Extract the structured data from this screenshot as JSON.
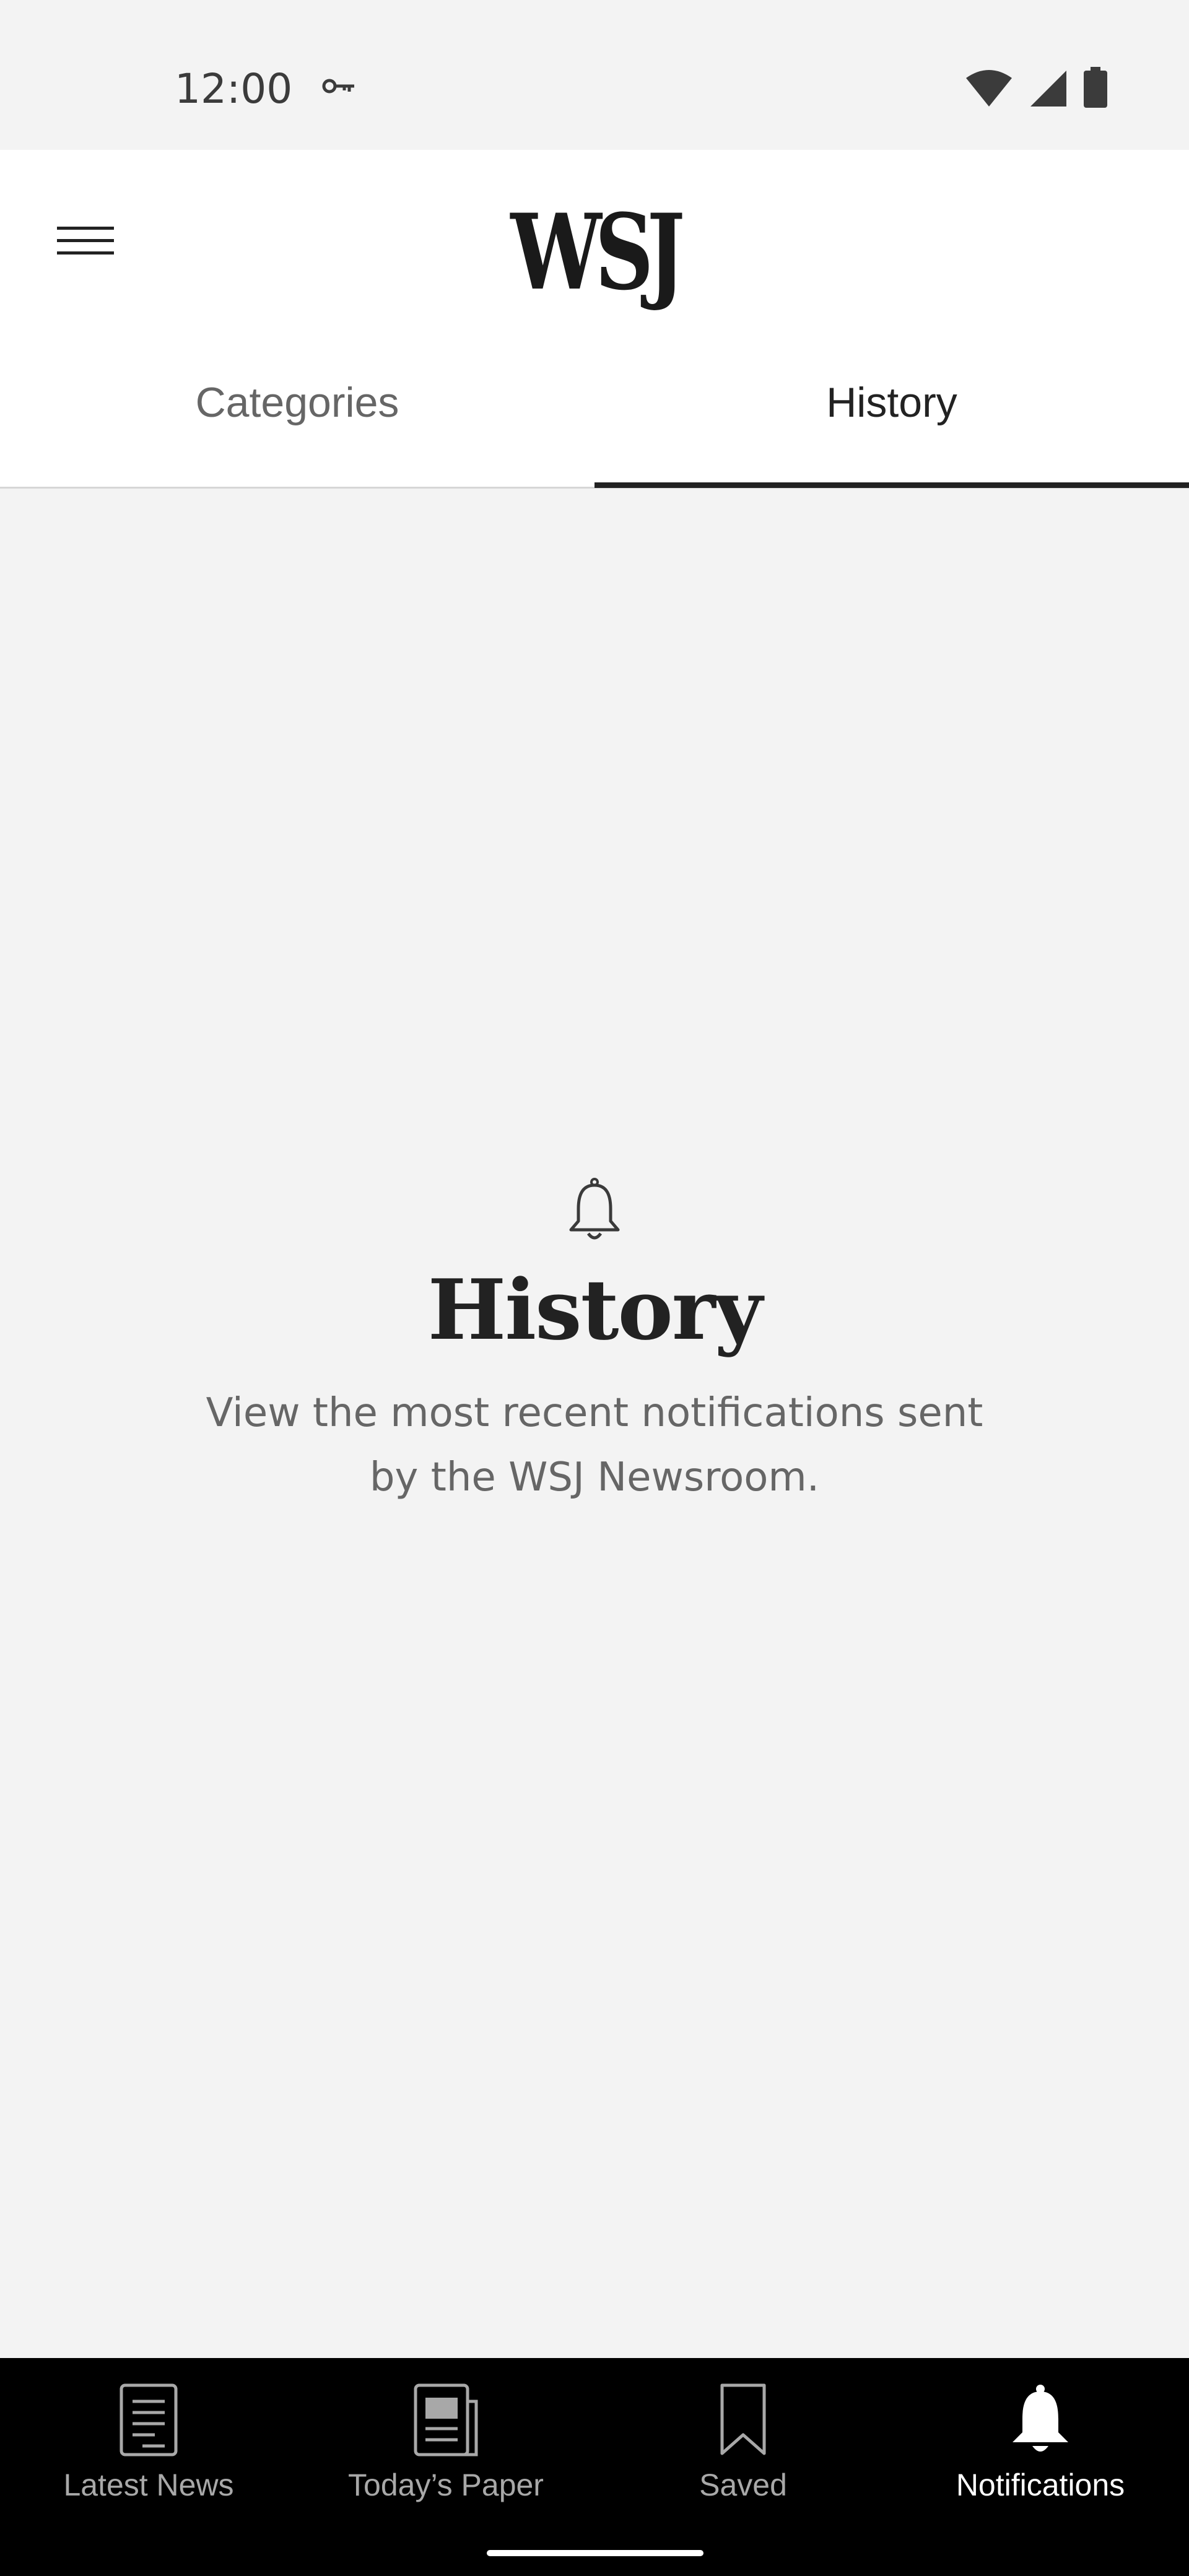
{
  "status_bar": {
    "time": "12:00",
    "icons": [
      "vpn-key-icon",
      "wifi-icon",
      "cell-signal-icon",
      "battery-icon"
    ]
  },
  "header": {
    "logo": "WSJ",
    "menu_icon": "hamburger-menu-icon"
  },
  "tabs": [
    {
      "label": "Categories",
      "active": false
    },
    {
      "label": "History",
      "active": true
    }
  ],
  "empty_state": {
    "icon": "bell-outline-icon",
    "title": "History",
    "description": "View the most recent notifications sent by the WSJ Newsroom."
  },
  "bottom_nav": {
    "items": [
      {
        "label": "Latest News",
        "icon": "news-list-icon",
        "active": false
      },
      {
        "label": "Today’s Paper",
        "icon": "newspaper-icon",
        "active": false
      },
      {
        "label": "Saved",
        "icon": "bookmark-icon",
        "active": false
      },
      {
        "label": "Notifications",
        "icon": "bell-filled-icon",
        "active": true
      }
    ]
  },
  "colors": {
    "page_background": "#f3f3f3",
    "header_background": "#ffffff",
    "nav_background": "#000000",
    "active_text": "#222222",
    "inactive_text": "#666666",
    "nav_inactive": "#a8a8a8",
    "nav_active": "#ffffff"
  }
}
